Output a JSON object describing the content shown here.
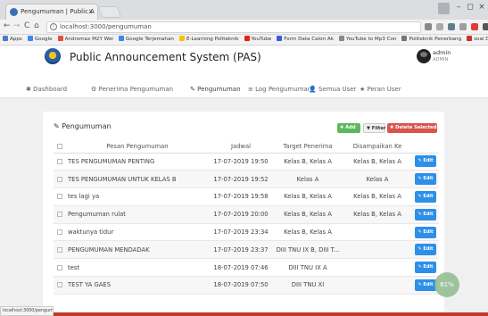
{
  "browser": {
    "tab_title": "Pengumuman | Public A",
    "tab_close": "x",
    "url": "localhost:3000/pengumuman",
    "window_controls": [
      "–",
      "◻",
      "×"
    ],
    "bookmarks": [
      {
        "label": "Apps",
        "color": "#4a7bd0"
      },
      {
        "label": "Google",
        "color": "#4285f4"
      },
      {
        "label": "Andromax M2Y Wei",
        "color": "#e74c3c"
      },
      {
        "label": "Google Terjemahan",
        "color": "#4285f4"
      },
      {
        "label": "E-Learning Politeknik",
        "color": "#f1c40f"
      },
      {
        "label": "YouTube",
        "color": "#e62117"
      },
      {
        "label": "Form Data Calon Ak",
        "color": "#3b5bdb"
      },
      {
        "label": "YouTube to Mp3 Con",
        "color": "#888888"
      },
      {
        "label": "Politeknik Penerbang",
        "color": "#777777"
      },
      {
        "label": "soal DUS BOX SAMS",
        "color": "#c0392b"
      }
    ],
    "status_url": "localhost:3000/pengumuman"
  },
  "app": {
    "title": "Public Announcement System (PAS)",
    "user_name": "admin",
    "user_role": "ADMIN"
  },
  "nav": [
    {
      "label": "Dashboard",
      "icon": "✱"
    },
    {
      "label": "Penerima Pengumuman",
      "icon": "⚙"
    },
    {
      "label": "Pengumuman",
      "icon": "✎"
    },
    {
      "label": "Log Pengumuman",
      "icon": "≡"
    },
    {
      "label": "Semua User",
      "icon": "👤"
    },
    {
      "label": "Peran User",
      "icon": "★"
    }
  ],
  "card": {
    "title": "Pengumuman",
    "btn_add": "✚ Add",
    "btn_filter": "▼ Filter",
    "btn_delete": "✖ Delete Selected"
  },
  "table": {
    "headers": [
      "",
      "Pesan Pengumuman",
      "Jadwal",
      "Target Penerima",
      "Disampaikan Ke",
      ""
    ],
    "edit_label": "Edit",
    "rows": [
      [
        "TES PENGUMUMAN PENTING",
        "17-07-2019 19:50",
        "Kelas B, Kelas A",
        "Kelas B, Kelas A"
      ],
      [
        "TES PENGUMUMAN UNTUK KELAS B",
        "17-07-2019 19:52",
        "Kelas A",
        "Kelas A"
      ],
      [
        "tes lagi ya",
        "17-07-2019 19:58",
        "Kelas B, Kelas A",
        "Kelas B, Kelas A"
      ],
      [
        "Pengumuman rulat",
        "17-07-2019 20:00",
        "Kelas B, Kelas A",
        "Kelas B, Kelas A"
      ],
      [
        "waktunya tidur",
        "17-07-2019 23:34",
        "Kelas B, Kelas A",
        ""
      ],
      [
        "PENGUMUMAN MENDADAK",
        "17-07-2019 23:37",
        "DIII TNU IX B, DIII T...",
        ""
      ],
      [
        "test",
        "18-07-2019 07:46",
        "DIII TNU IX A",
        ""
      ],
      [
        "TEST YA GAES",
        "18-07-2019 07:50",
        "DIII TNU XI",
        ""
      ]
    ]
  },
  "overlay_badge": "61%"
}
